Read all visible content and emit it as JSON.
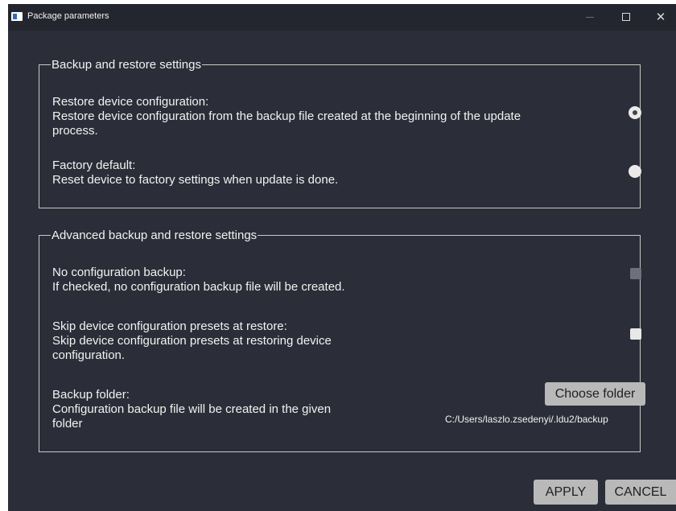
{
  "window": {
    "title": "Package parameters",
    "controls": {
      "minimize": "–",
      "maximize": "☐",
      "close": "✕"
    }
  },
  "backup_group": {
    "legend": "Backup and restore settings",
    "options": [
      {
        "title": "Restore device configuration:",
        "desc_line1": "Restore device configuration from the backup file created at the beginning of the update",
        "desc_line2": "process.",
        "selected": true
      },
      {
        "title": "Factory default:",
        "desc_line1": "Reset device to factory settings when update is done.",
        "selected": false
      }
    ]
  },
  "advanced_group": {
    "legend": "Advanced backup and restore settings",
    "no_config_backup": {
      "title": "No configuration backup:",
      "desc": "If checked, no configuration backup file will be created.",
      "checked": false,
      "enabled": false
    },
    "skip_presets": {
      "title": "Skip device configuration presets at restore:",
      "desc_line1": "Skip device configuration presets at restoring device",
      "desc_line2": "configuration.",
      "checked": false
    },
    "backup_folder": {
      "title": "Backup folder:",
      "desc_line1": "Configuration backup file will be created in the given",
      "desc_line2": "folder",
      "button_label": "Choose folder",
      "path": "C:/Users/laszlo.zsedenyi/.ldu2/backup"
    }
  },
  "footer": {
    "apply_label": "APPLY",
    "cancel_label": "CANCEL"
  },
  "colors": {
    "window_bg": "#2b2e38",
    "titlebar_bg": "#23262e",
    "button_bg": "#b9b9b9"
  }
}
